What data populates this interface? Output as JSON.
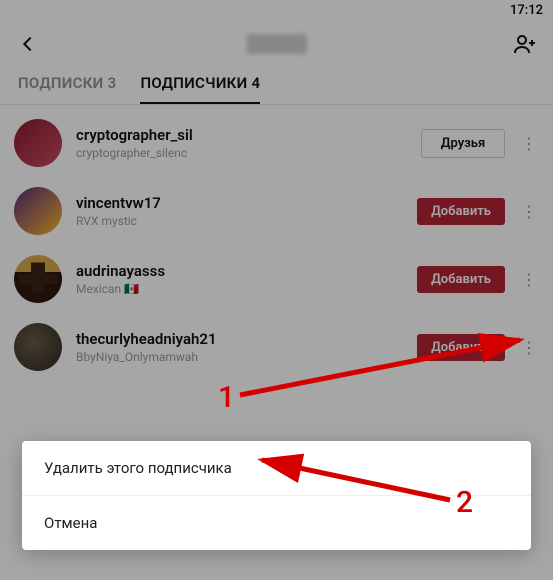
{
  "status": {
    "time": "17:12"
  },
  "tabs": {
    "subscriptions": {
      "label": "ПОДПИСКИ",
      "count": "3"
    },
    "followers": {
      "label": "ПОДПИСЧИКИ",
      "count": "4"
    }
  },
  "buttons": {
    "friends": "Друзья",
    "add": "Добавить"
  },
  "followers": [
    {
      "username": "cryptographer_sil",
      "sub": "cryptographer_silenc",
      "action": "friends"
    },
    {
      "username": "vincentvw17",
      "sub": "RVX mystic",
      "action": "add"
    },
    {
      "username": "audrinayasss",
      "sub": "Mexican 🇲🇽",
      "action": "add"
    },
    {
      "username": "thecurlyheadniyah21",
      "sub": "BbyNiya_Onlymamwah",
      "action": "add"
    }
  ],
  "sheet": {
    "remove": "Удалить этого подписчика",
    "cancel": "Отмена"
  },
  "annotations": {
    "step1": "1",
    "step2": "2"
  }
}
